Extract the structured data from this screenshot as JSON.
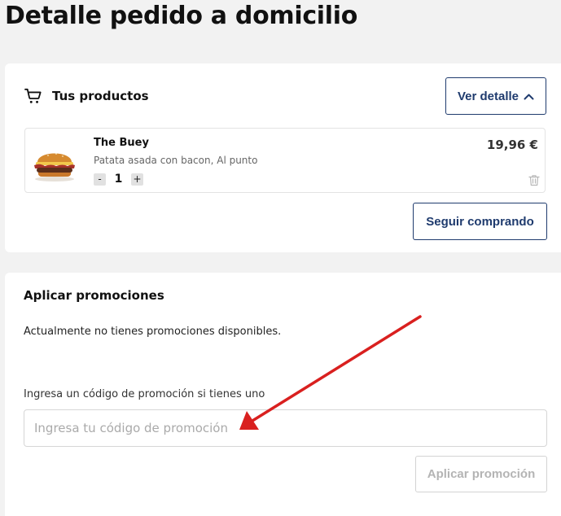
{
  "page": {
    "title": "Detalle pedido a domicilio"
  },
  "products": {
    "title": "Tus productos",
    "cart_icon": "shopping-cart-icon",
    "detail_button": {
      "label": "Ver detalle",
      "icon": "chevron-up-icon"
    },
    "items": [
      {
        "name": "The Buey",
        "description": "Patata asada con bacon, Al punto",
        "quantity": "1",
        "decrement": "-",
        "increment": "+",
        "price": "19,96 €",
        "image": "burger-image",
        "delete_icon": "trash-icon"
      }
    ],
    "continue_button": "Seguir comprando"
  },
  "promotions": {
    "title": "Aplicar promociones",
    "none_message": "Actualmente no tienes promociones disponibles.",
    "code_label": "Ingresa un código de promoción si tienes uno",
    "code_input": {
      "value": "",
      "placeholder": "Ingresa tu código de promoción"
    },
    "apply_button": "Aplicar promoción"
  },
  "annotation": {
    "type": "arrow",
    "color": "#d9201f"
  },
  "colors": {
    "accent": "#1f3b6e",
    "background": "#f2f2f2",
    "disabled": "#b4b4b4"
  }
}
